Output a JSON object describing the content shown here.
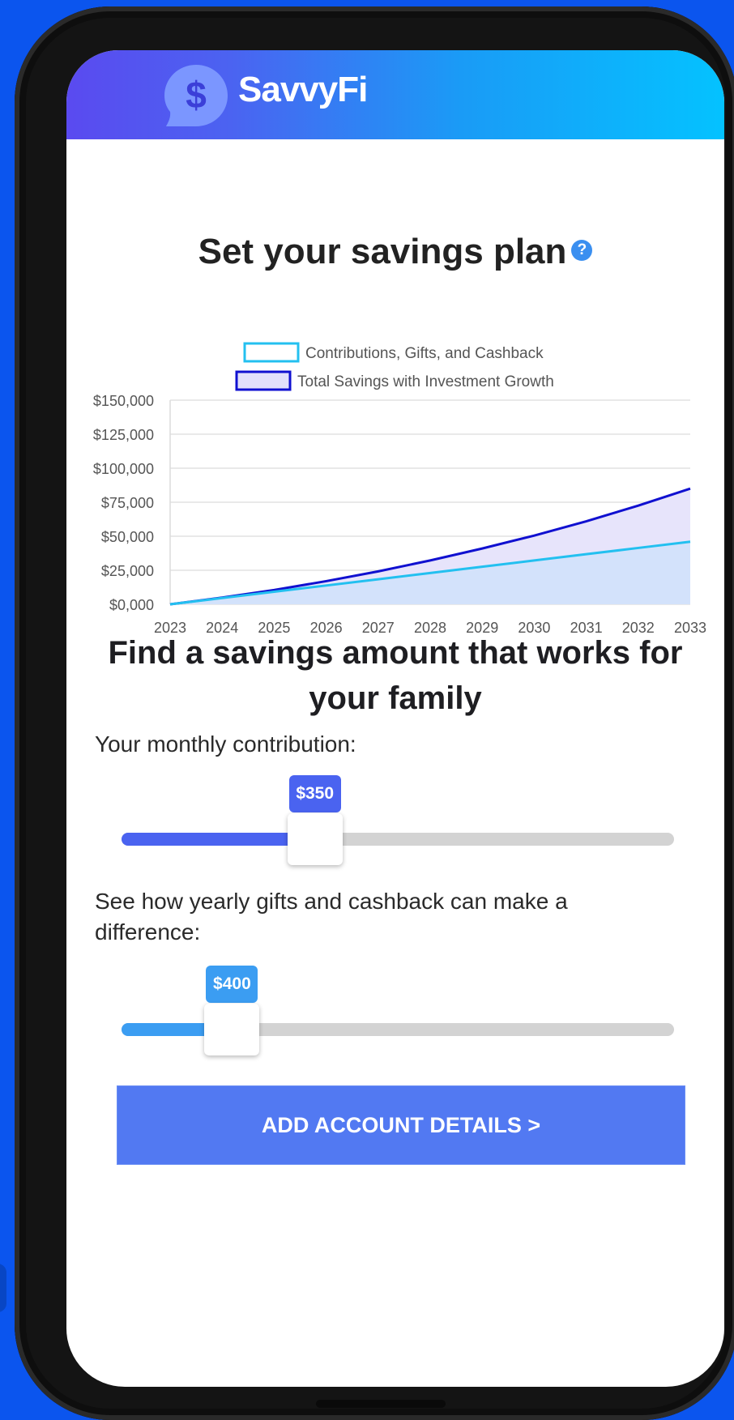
{
  "app": {
    "brand": "SavvyFi",
    "logo_symbol": "$"
  },
  "colors": {
    "contribution_line": "#23c0f0",
    "total_line": "#1010d0",
    "slider1_fill": "#4a63f0",
    "slider2_fill": "#3b9df2",
    "button_bg": "#5279f2"
  },
  "plan": {
    "title": "Set your savings plan",
    "help_icon": "question-circle-icon",
    "help_glyph": "?"
  },
  "chart_data": {
    "type": "area",
    "legend": [
      {
        "name": "Contributions, Gifts, and Cashback"
      },
      {
        "name": "Total Savings with Investment Growth"
      }
    ],
    "x": [
      "2023",
      "2024",
      "2025",
      "2026",
      "2027",
      "2028",
      "2029",
      "2030",
      "2031",
      "2032",
      "2033"
    ],
    "series": [
      {
        "name": "Contributions, Gifts, and Cashback",
        "values": [
          0,
          4600,
          9200,
          13800,
          18400,
          23000,
          27600,
          32200,
          36800,
          41400,
          46000
        ]
      },
      {
        "name": "Total Savings with Investment Growth",
        "values": [
          0,
          4900,
          10500,
          17000,
          24200,
          32200,
          41000,
          50500,
          61000,
          72500,
          85000
        ]
      }
    ],
    "yticks": [
      "$150,000",
      "$125,000",
      "$100,000",
      "$75,000",
      "$50,000",
      "$25,000",
      "$0,000"
    ],
    "ylim": [
      0,
      150000
    ],
    "grid": true,
    "legend_placement": "top-center"
  },
  "savings": {
    "title": "Find a savings amount that works for your family",
    "monthly_label": "Your monthly contribution:",
    "monthly_value": "$350",
    "monthly_fraction": 0.35,
    "gifts_label": "See how yearly gifts and cashback can make a difference:",
    "gifts_value": "$400",
    "gifts_fraction": 0.2
  },
  "cta": {
    "label": "ADD ACCOUNT DETAILS >"
  }
}
